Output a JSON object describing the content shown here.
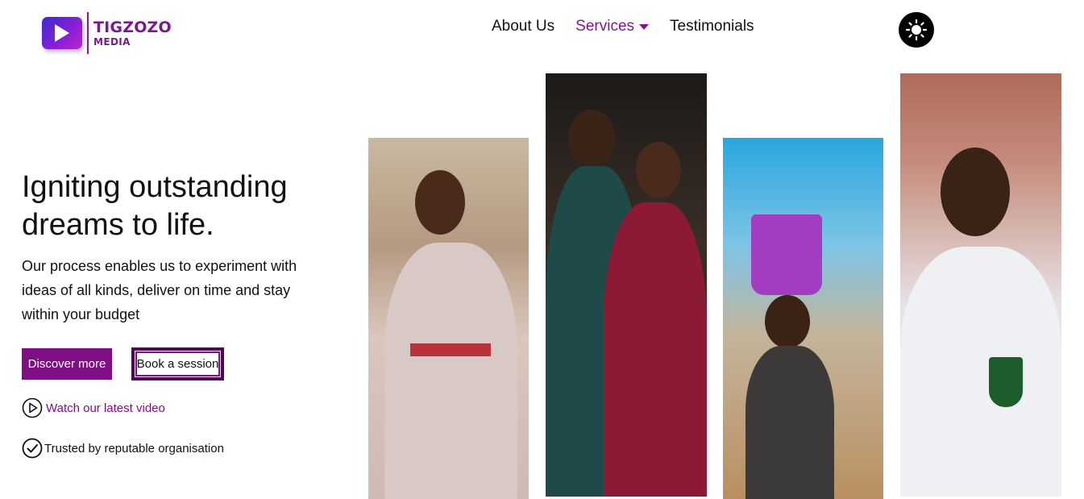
{
  "brand": {
    "name": "TIGZOZO",
    "sub": "MEDIA"
  },
  "nav": {
    "items": [
      "About Us",
      "Services",
      "Testimonials"
    ]
  },
  "hero": {
    "title": "Igniting outstanding dreams to life.",
    "description": "Our process enables us to experiment with ideas of all kinds, deliver on time and stay within your budget",
    "primary_button": "Discover more",
    "secondary_button": "Book a session",
    "video_link": "Watch our latest video",
    "trusted_text": "Trusted by reputable organisation"
  },
  "colors": {
    "accent": "#800f86",
    "text": "#111111",
    "background": "#ffffff"
  },
  "icons": {
    "theme": "sun-icon",
    "video": "play-circle-icon",
    "trusted": "check-circle-icon",
    "services": "caret-down-icon"
  }
}
